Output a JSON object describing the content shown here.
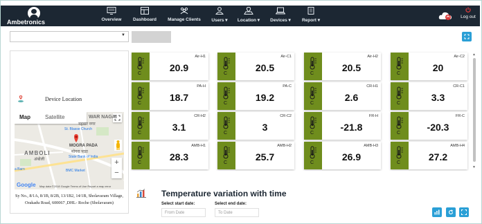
{
  "brand": "Ambetronics",
  "nav": [
    {
      "label": "Overview",
      "icon": "display-icon"
    },
    {
      "label": "Dashboard",
      "icon": "dashboard-icon"
    },
    {
      "label": "Manage Clients",
      "icon": "clients-icon"
    },
    {
      "label": "Users",
      "icon": "user-icon"
    },
    {
      "label": "Location",
      "icon": "location-icon"
    },
    {
      "label": "Devices",
      "icon": "laptop-icon"
    },
    {
      "label": "Report",
      "icon": "report-icon"
    }
  ],
  "logout_label": "Log out",
  "device_location_label": "Device Location",
  "map": {
    "tab_map": "Map",
    "tab_satellite": "Satellite",
    "area_top": "WAR NAGAI",
    "area_top_local": "नहवार नगर",
    "church": "St. Blasse Church",
    "place": "MOGRA PADA",
    "place_local": "मोगरा पाडा",
    "amboli": "AMBOLI",
    "amboli_local": "अंबोली",
    "bank": "State Bank of India",
    "market": "BMC Market",
    "barn": "a Barn",
    "google": "Google",
    "footer": "Map data ©2018 Google   Terms of Use   Report a map error"
  },
  "address": "Sy No., 8/1A, 8/1B, 8/2B, 13/1B2, 14/1B, Sholavaram Village, Orakadu Road, 600067 ,DHL- Roche (Sholavaram)",
  "unit": "C",
  "tiles": [
    {
      "label": "Air-H1",
      "value": "20.9"
    },
    {
      "label": "Air-C1",
      "value": "20.5"
    },
    {
      "label": "Air-H2",
      "value": "20.5"
    },
    {
      "label": "Air-C2",
      "value": "20"
    },
    {
      "label": "PA-H",
      "value": "18.7"
    },
    {
      "label": "PA-C",
      "value": "19.2"
    },
    {
      "label": "CR-H1",
      "value": "2.6"
    },
    {
      "label": "CR-C1",
      "value": "3.3"
    },
    {
      "label": "CR-H2",
      "value": "3.1"
    },
    {
      "label": "CR-C2",
      "value": "3"
    },
    {
      "label": "FR-H",
      "value": "-21.8"
    },
    {
      "label": "FR-C",
      "value": "-20.3"
    },
    {
      "label": "AMB-H1",
      "value": "28.3"
    },
    {
      "label": "AMB-H2",
      "value": "25.7"
    },
    {
      "label": "AMB-H3",
      "value": "26.9"
    },
    {
      "label": "AMB-H4",
      "value": "27.2"
    }
  ],
  "chart_section": {
    "title": "Temperature variation with time",
    "start_label": "Select start date:",
    "end_label": "Select end date:",
    "start_placeholder": "From Date",
    "end_placeholder": "To Date"
  },
  "colors": {
    "nav_bg": "#1c2733",
    "tile_green": "#6f8d1d",
    "accent_blue": "#2a9fd6"
  }
}
